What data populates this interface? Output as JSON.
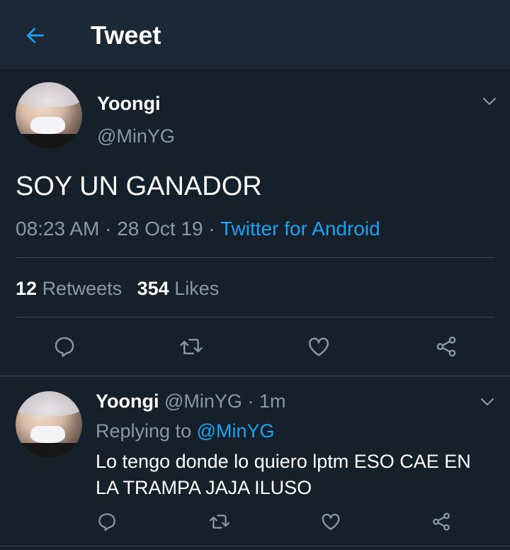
{
  "header": {
    "title": "Tweet",
    "back_icon": "arrow-left-icon",
    "accent": "#1da1f2"
  },
  "main_tweet": {
    "name": "Yoongi",
    "handle": "@MinYG",
    "text": "SOY UN GANADOR",
    "time": "08:23 AM",
    "sep1": "·",
    "date": "28 Oct 19",
    "sep2": "·",
    "source": "Twitter for Android",
    "retweets_count": "12",
    "retweets_label": "Retweets",
    "likes_count": "354",
    "likes_label": "Likes"
  },
  "reply": {
    "name": "Yoongi",
    "handle": "@MinYG",
    "sep": "·",
    "time": "1m",
    "replying_label": "Replying to",
    "replying_handle": "@MinYG",
    "text_line1": "Lo tengo donde lo quiero lptm ESO CAE EN",
    "text_line2": "LA TRAMPA JAJA ILUSO"
  },
  "colors": {
    "background": "#15202b",
    "header": "#1b2836",
    "muted": "#8899a6",
    "divider": "#38444d"
  }
}
